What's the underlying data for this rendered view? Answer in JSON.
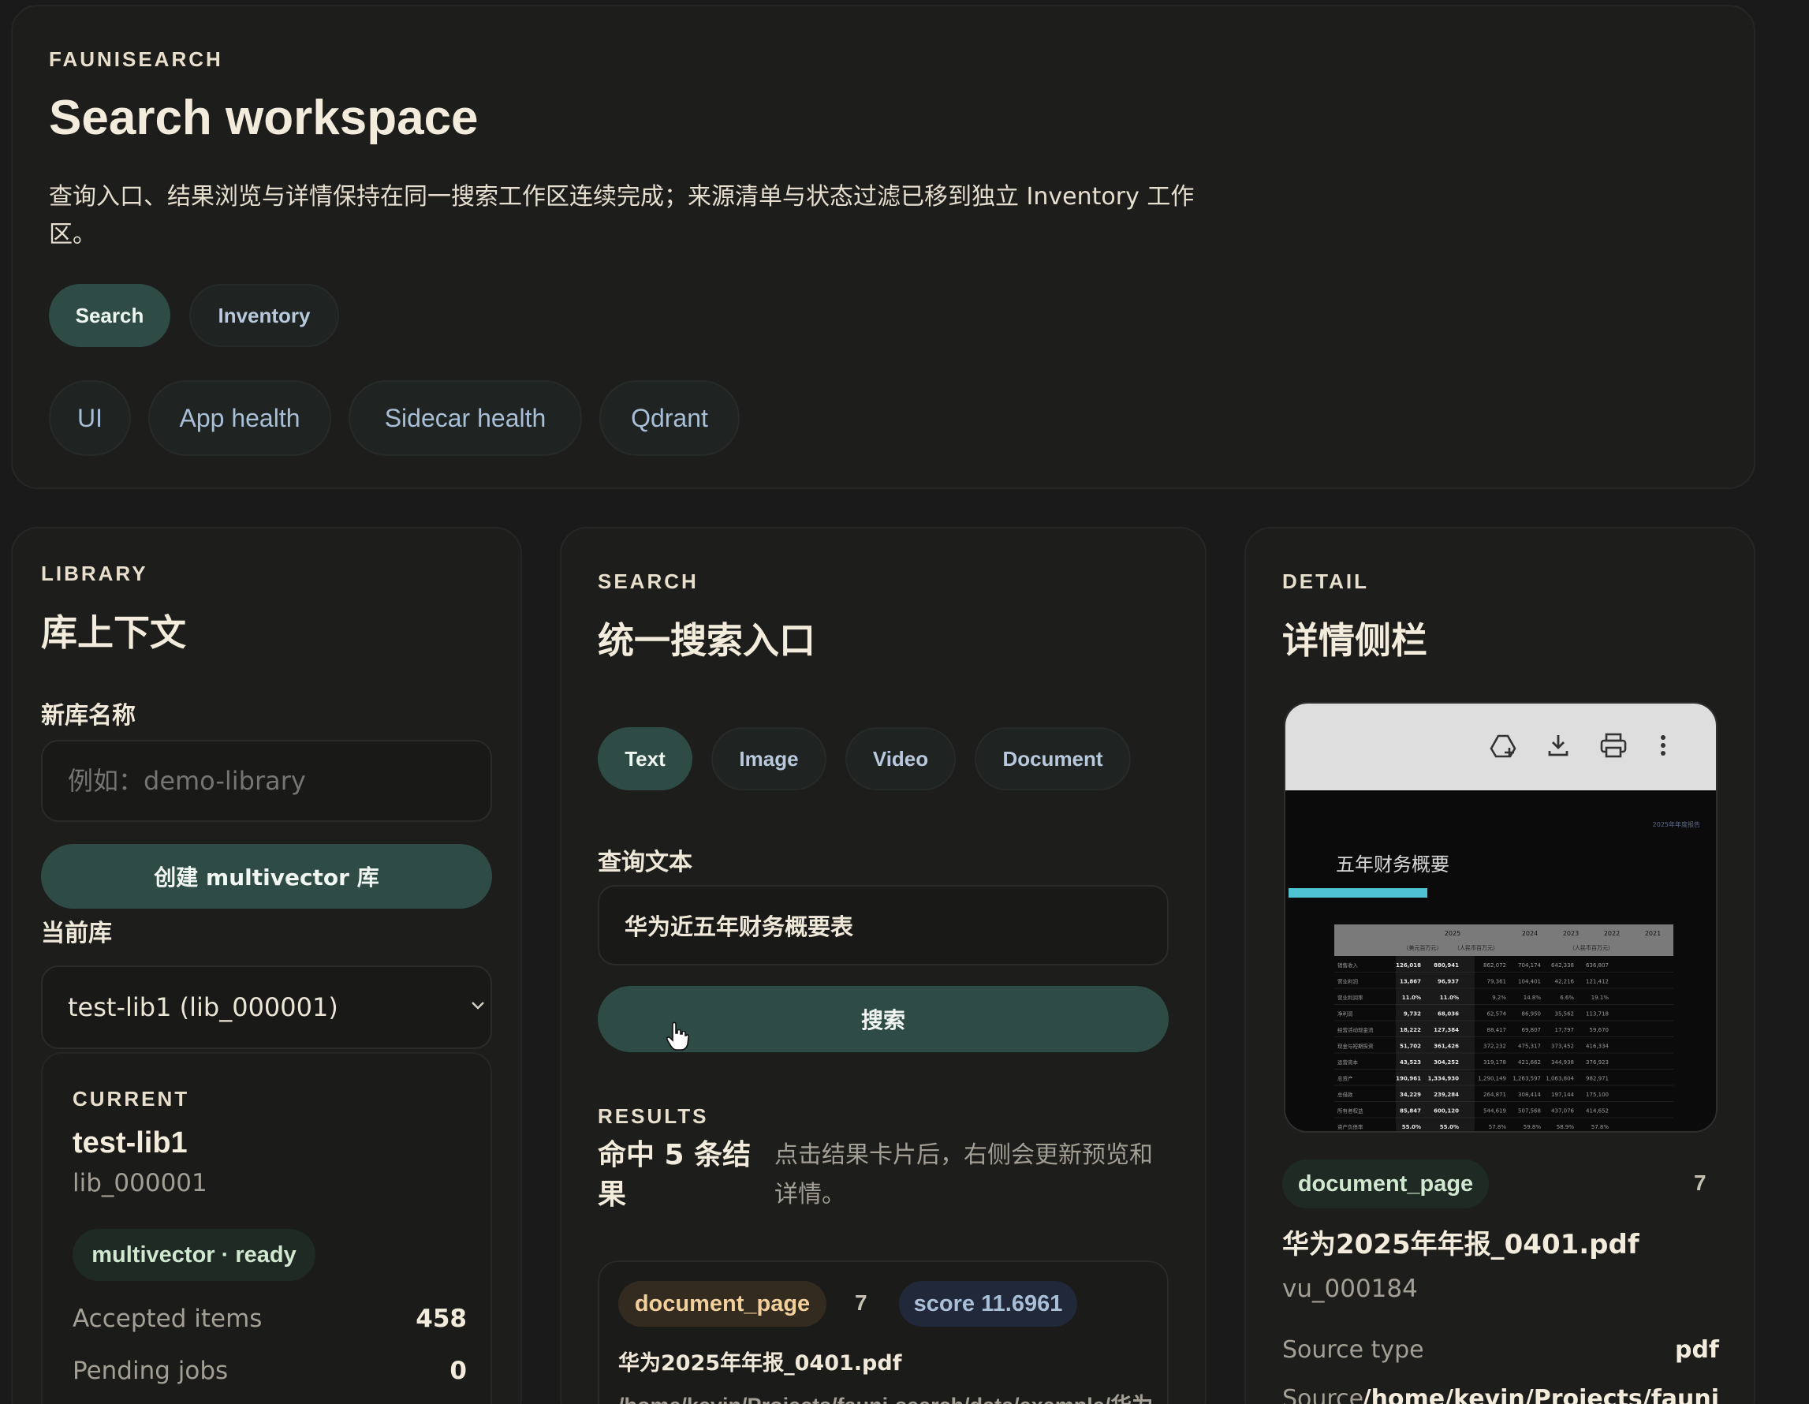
{
  "header": {
    "eyebrow": "FAUNISEARCH",
    "title": "Search workspace",
    "description_line1": "查询入口、结果浏览与详情保持在同一搜索工作区连续完成；来源清单与状态过滤已移到独立 Inventory 工作",
    "description_line2": "区。",
    "tabs": [
      {
        "label": "Search",
        "active": true
      },
      {
        "label": "Inventory",
        "active": false
      }
    ],
    "status_pills": [
      "UI",
      "App health",
      "Sidecar health",
      "Qdrant"
    ]
  },
  "library": {
    "eyebrow": "LIBRARY",
    "title": "库上下文",
    "new_name_label": "新库名称",
    "new_name_placeholder": "例如：demo-library",
    "create_button": "创建 multivector 库",
    "current_label": "当前库",
    "current_select": "test-lib1 (lib_000001)",
    "current": {
      "eyebrow": "CURRENT",
      "name": "test-lib1",
      "id": "lib_000001",
      "badge": "multivector · ready",
      "stats": [
        {
          "label": "Accepted items",
          "value": "458"
        },
        {
          "label": "Pending jobs",
          "value": "0"
        }
      ]
    }
  },
  "search": {
    "eyebrow": "SEARCH",
    "title": "统一搜索入口",
    "modes": [
      {
        "label": "Text",
        "active": true
      },
      {
        "label": "Image",
        "active": false
      },
      {
        "label": "Video",
        "active": false
      },
      {
        "label": "Document",
        "active": false
      }
    ],
    "query_label": "查询文本",
    "query_value": "华为近五年财务概要表",
    "search_button": "搜索",
    "results": {
      "eyebrow": "RESULTS",
      "count_line1": "命中 5 条结",
      "count_line2": "果",
      "hint_line1": "点击结果卡片后，右侧会更新预览和",
      "hint_line2": "详情。",
      "first": {
        "kind": "document_page",
        "page": "7",
        "score": "score 11.6961",
        "filename": "华为2025年年报_0401.pdf",
        "path": "/home/kevin/Projects/fauni-search/data/example/华为"
      }
    }
  },
  "detail": {
    "eyebrow": "DETAIL",
    "title": "详情侧栏",
    "preview": {
      "heading": "五年财务概要",
      "corner_note": "2025年年度报告",
      "toolbar_icons": [
        "add-to-drive-icon",
        "download-icon",
        "print-icon",
        "more-vert-icon"
      ],
      "table": {
        "year_headers": [
          "2025",
          "2024",
          "2023",
          "2022",
          "2021"
        ],
        "unit_headers": [
          "（美元百万元）",
          "（人民币百万元）",
          "（人民币百万元）"
        ],
        "rows": [
          [
            "销售收入",
            "126,018",
            "880,941",
            "862,072",
            "704,174",
            "642,338",
            "636,807"
          ],
          [
            "营业利润",
            "13,867",
            "96,937",
            "79,361",
            "104,401",
            "42,216",
            "121,412"
          ],
          [
            "营业利润率",
            "11.0%",
            "11.0%",
            "9.2%",
            "14.8%",
            "6.6%",
            "19.1%"
          ],
          [
            "净利润",
            "9,732",
            "68,036",
            "62,574",
            "86,950",
            "35,562",
            "113,718"
          ],
          [
            "经营活动现金流",
            "18,222",
            "127,384",
            "88,417",
            "69,807",
            "17,797",
            "59,670"
          ],
          [
            "现金与短期投资",
            "51,702",
            "361,426",
            "372,232",
            "475,317",
            "373,452",
            "416,334"
          ],
          [
            "运营资本",
            "43,523",
            "304,252",
            "319,178",
            "421,662",
            "344,938",
            "376,923"
          ],
          [
            "总资产",
            "190,961",
            "1,334,930",
            "1,290,149",
            "1,263,597",
            "1,063,804",
            "982,971"
          ],
          [
            "总借款",
            "34,229",
            "239,284",
            "264,871",
            "308,414",
            "197,144",
            "175,100"
          ],
          [
            "所有者权益",
            "85,847",
            "600,120",
            "544,619",
            "507,568",
            "437,076",
            "414,652"
          ],
          [
            "资产负债率",
            "55.0%",
            "55.0%",
            "57.8%",
            "59.8%",
            "58.9%",
            "57.8%"
          ]
        ]
      }
    },
    "kind": "document_page",
    "page": "7",
    "filename": "华为2025年年报_0401.pdf",
    "vu_id": "vu_000184",
    "meta": [
      {
        "label": "Source type",
        "value": "pdf"
      },
      {
        "label": "Source",
        "value": "/home/kevin/Projects/fauni"
      }
    ]
  },
  "colors": {
    "background": "#1a1a1a",
    "accent": "#2e4c45",
    "preview_bar": "#4fc3d1"
  }
}
